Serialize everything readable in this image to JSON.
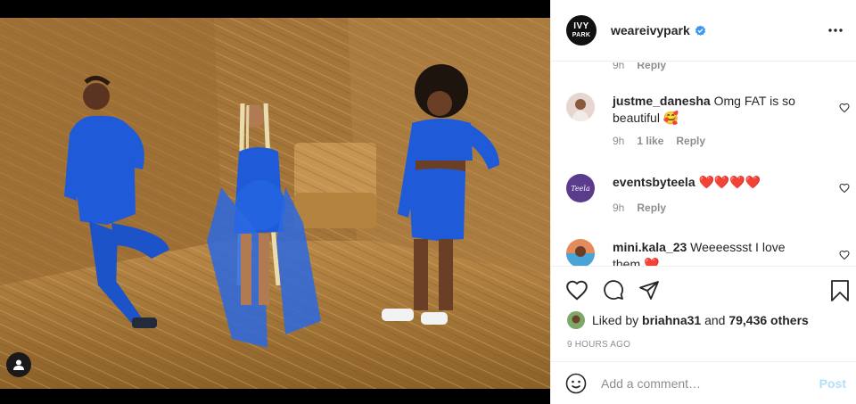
{
  "header": {
    "avatar_text_line1": "IVY",
    "avatar_text_line2": "PARK",
    "username": "weareivypark",
    "verified_icon": "verified-badge-icon",
    "more_icon": "more-horizontal-icon"
  },
  "comments": {
    "top_partial": {
      "time": "9h",
      "reply_label": "Reply"
    },
    "items": [
      {
        "username": "justme_danesha",
        "text": "Omg FAT is so beautiful 🥰",
        "time": "9h",
        "likes": "1 like",
        "reply_label": "Reply"
      },
      {
        "username": "eventsbyteela",
        "text": "❤️❤️❤️❤️",
        "time": "9h",
        "reply_label": "Reply",
        "avatar_text": "Teela"
      },
      {
        "username": "mini.kala_23",
        "text": "Weeeessst I love them ❤️",
        "time": "",
        "reply_label": ""
      }
    ]
  },
  "actions": {
    "like_icon": "heart-icon",
    "comment_icon": "comment-icon",
    "share_icon": "paper-plane-icon",
    "save_icon": "bookmark-icon",
    "liked_by_prefix": "Liked by ",
    "liked_by_user": "briahna31",
    "liked_by_and": " and ",
    "liked_by_others": "79,436 others",
    "timestamp": "9 HOURS AGO"
  },
  "composer": {
    "emoji_icon": "smiley-icon",
    "placeholder": "Add a comment…",
    "post_label": "Post"
  },
  "photo": {
    "tag_icon": "user-tag-icon",
    "accent": "#1f5bd8"
  }
}
